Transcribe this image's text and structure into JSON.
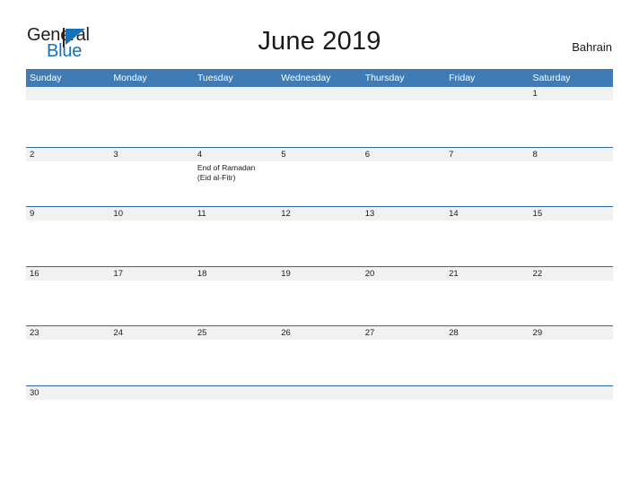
{
  "header": {
    "logo": {
      "word_primary": "General",
      "word_secondary": "Blue",
      "primary_color": "#231f20",
      "secondary_color": "#1572b8"
    },
    "title": "June 2019",
    "country": "Bahrain"
  },
  "theme": {
    "header_blue": "#3f7cb6",
    "rule_blue": "#2b6ca8",
    "band_gray": "#f1f1f1",
    "text_dark": "#1a1a1a"
  },
  "calendar": {
    "month": "June",
    "year": "2019",
    "weekday_headers": [
      "Sunday",
      "Monday",
      "Tuesday",
      "Wednesday",
      "Thursday",
      "Friday",
      "Saturday"
    ],
    "weeks": [
      {
        "days": [
          {
            "number": "",
            "events": []
          },
          {
            "number": "",
            "events": []
          },
          {
            "number": "",
            "events": []
          },
          {
            "number": "",
            "events": []
          },
          {
            "number": "",
            "events": []
          },
          {
            "number": "",
            "events": []
          },
          {
            "number": "1",
            "events": []
          }
        ]
      },
      {
        "days": [
          {
            "number": "2",
            "events": []
          },
          {
            "number": "3",
            "events": []
          },
          {
            "number": "4",
            "events": [
              "End of Ramadan",
              "(Eid al-Fitr)"
            ]
          },
          {
            "number": "5",
            "events": []
          },
          {
            "number": "6",
            "events": []
          },
          {
            "number": "7",
            "events": []
          },
          {
            "number": "8",
            "events": []
          }
        ]
      },
      {
        "days": [
          {
            "number": "9",
            "events": []
          },
          {
            "number": "10",
            "events": []
          },
          {
            "number": "11",
            "events": []
          },
          {
            "number": "12",
            "events": []
          },
          {
            "number": "13",
            "events": []
          },
          {
            "number": "14",
            "events": []
          },
          {
            "number": "15",
            "events": []
          }
        ]
      },
      {
        "days": [
          {
            "number": "16",
            "events": []
          },
          {
            "number": "17",
            "events": []
          },
          {
            "number": "18",
            "events": []
          },
          {
            "number": "19",
            "events": []
          },
          {
            "number": "20",
            "events": []
          },
          {
            "number": "21",
            "events": []
          },
          {
            "number": "22",
            "events": []
          }
        ]
      },
      {
        "days": [
          {
            "number": "23",
            "events": []
          },
          {
            "number": "24",
            "events": []
          },
          {
            "number": "25",
            "events": []
          },
          {
            "number": "26",
            "events": []
          },
          {
            "number": "27",
            "events": []
          },
          {
            "number": "28",
            "events": []
          },
          {
            "number": "29",
            "events": []
          }
        ]
      },
      {
        "days": [
          {
            "number": "30",
            "events": []
          },
          {
            "number": "",
            "events": []
          },
          {
            "number": "",
            "events": []
          },
          {
            "number": "",
            "events": []
          },
          {
            "number": "",
            "events": []
          },
          {
            "number": "",
            "events": []
          },
          {
            "number": "",
            "events": []
          }
        ]
      }
    ]
  }
}
